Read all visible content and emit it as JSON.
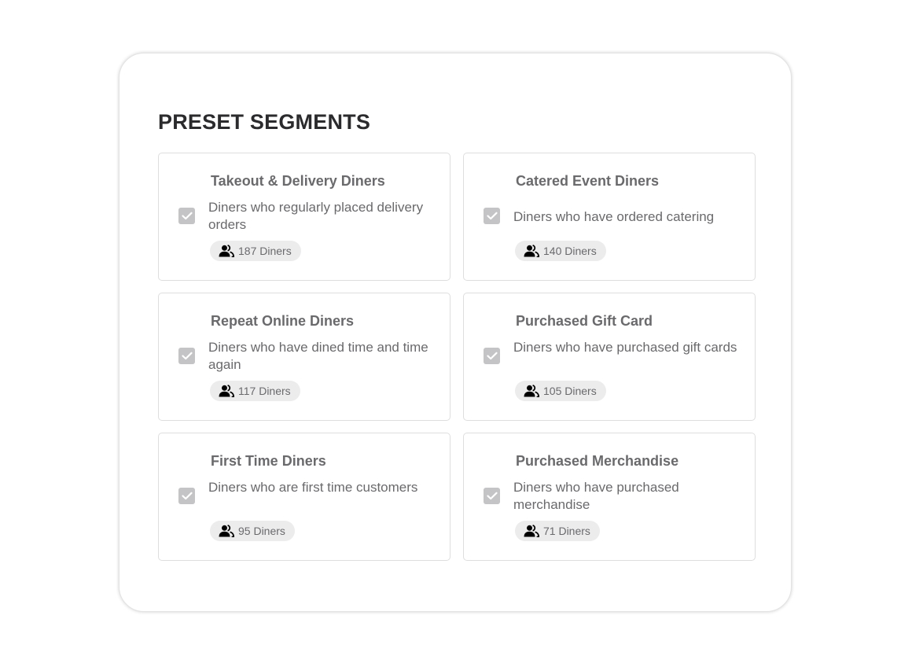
{
  "page": {
    "title": "PRESET SEGMENTS"
  },
  "segments": [
    {
      "title": "Takeout & Delivery Diners",
      "description": "Diners who regularly placed delivery orders",
      "diners": "187 Diners",
      "checked": true
    },
    {
      "title": "Catered Event Diners",
      "description": "Diners who have ordered catering",
      "diners": "140 Diners",
      "checked": true
    },
    {
      "title": "Repeat Online Diners",
      "description": "Diners who have dined time and time again",
      "diners": "117 Diners",
      "checked": true
    },
    {
      "title": "Purchased Gift Card",
      "description": "Diners who have purchased gift cards",
      "diners": "105 Diners",
      "checked": true
    },
    {
      "title": "First Time Diners",
      "description": "Diners who are first time customers",
      "diners": "95 Diners",
      "checked": true
    },
    {
      "title": "Purchased Merchandise",
      "description": "Diners who have purchased merchandise",
      "diners": "71 Diners",
      "checked": true
    }
  ],
  "icons": {
    "checkbox": "check-icon",
    "diners": "users-icon"
  },
  "colors": {
    "checkbox_fill": "#c4c4c6",
    "chip_background": "#ececed",
    "title_text": "#2b2b2e",
    "body_text": "#6a6a6d"
  }
}
